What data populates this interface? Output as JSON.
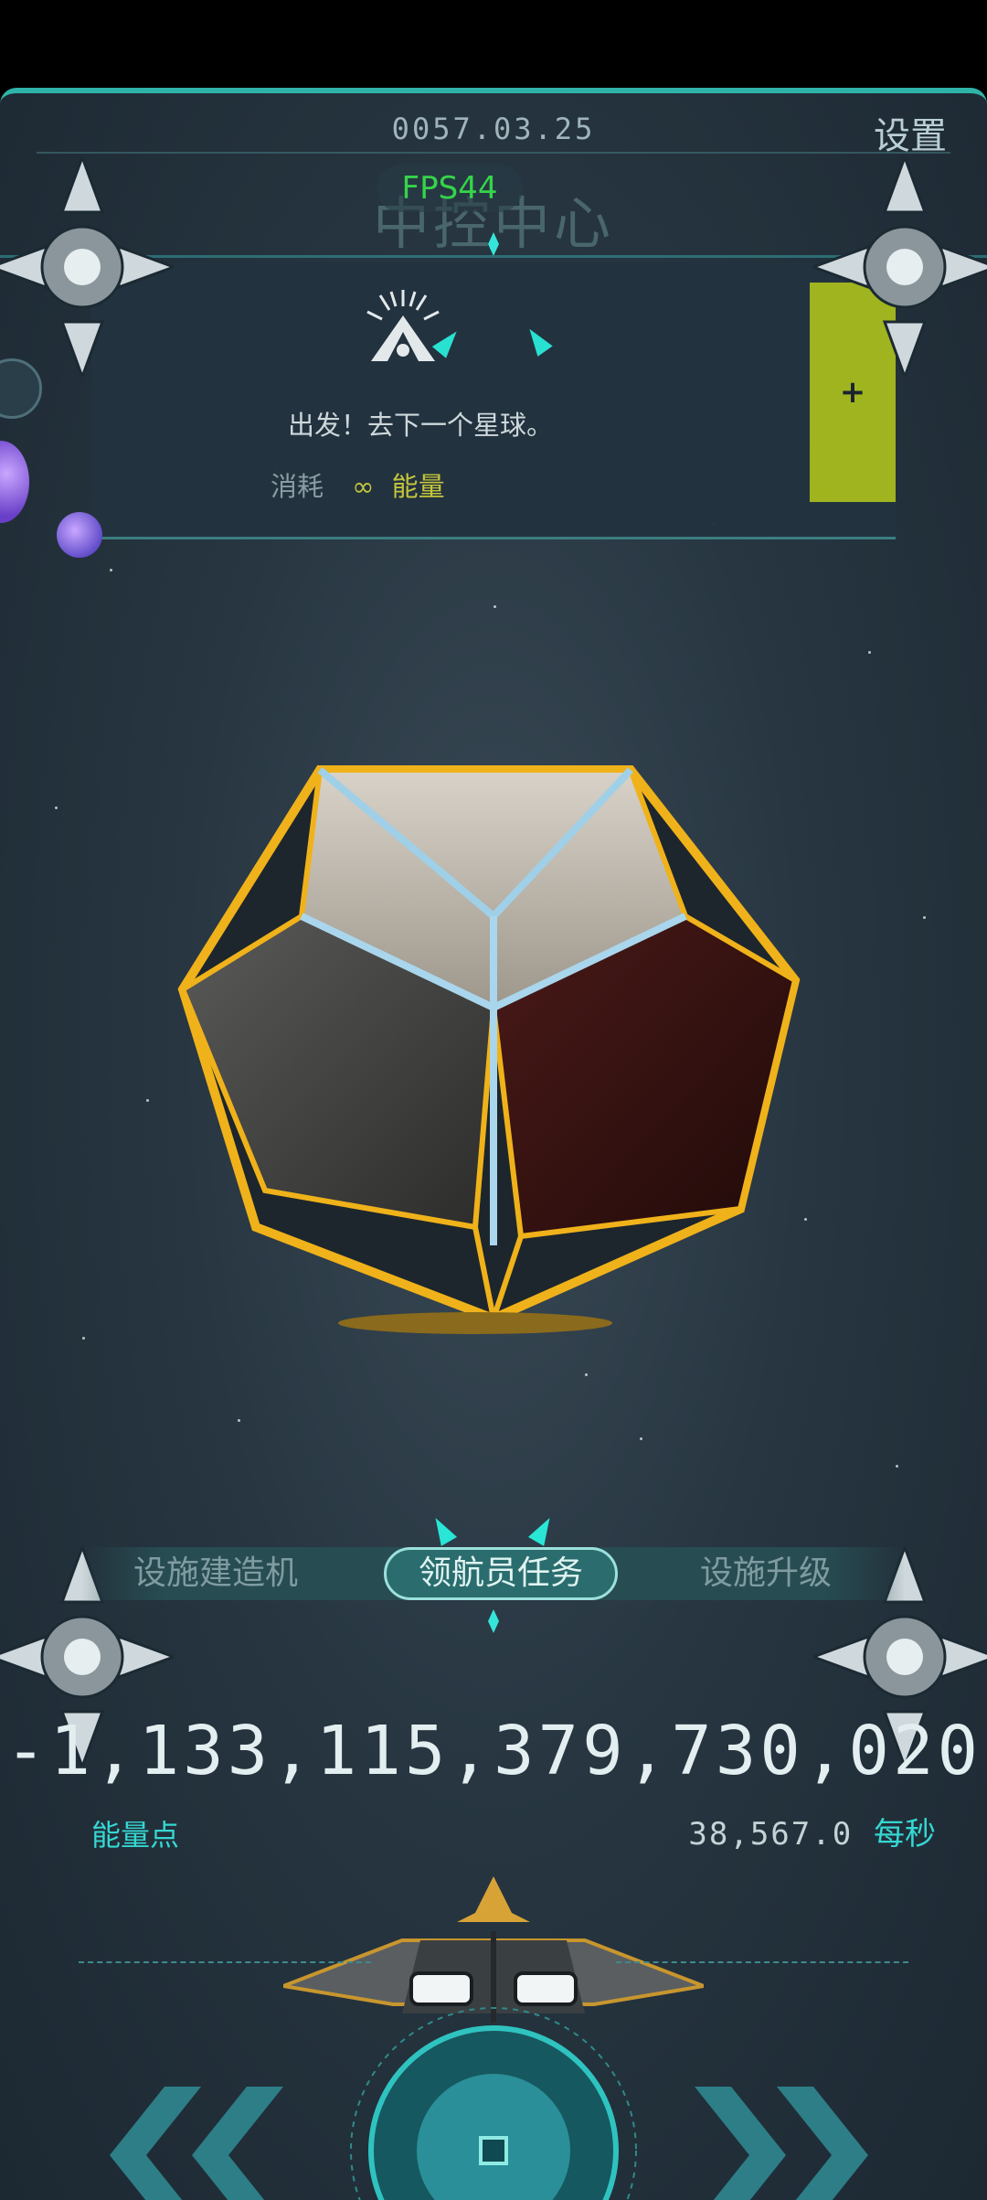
{
  "header": {
    "date": "0057.03.25",
    "settings_label": "设置",
    "title": "中控中心",
    "fps": "FPS44"
  },
  "task": {
    "description": "出发！去下一个星球。",
    "cost_label": "消耗",
    "cost_value": "∞",
    "cost_unit": "能量",
    "add_label": "+"
  },
  "tabs": [
    {
      "label": "设施建造机",
      "active": false
    },
    {
      "label": "领航员任务",
      "active": true
    },
    {
      "label": "设施升级",
      "active": false
    }
  ],
  "energy": {
    "total": "-1,133,115,379,730,020",
    "label": "能量点",
    "rate": "38,567.0",
    "rate_unit": "每秒"
  },
  "colors": {
    "accent": "#35d7d2",
    "action": "#a3b81e",
    "fps": "#35d44a",
    "core_edge": "#f0b21a"
  },
  "icons": [
    "beacon-icon",
    "back-arrow-icon",
    "forward-arrow-icon",
    "dial-icon",
    "drone-icon",
    "ship-icon",
    "planet-icon"
  ]
}
